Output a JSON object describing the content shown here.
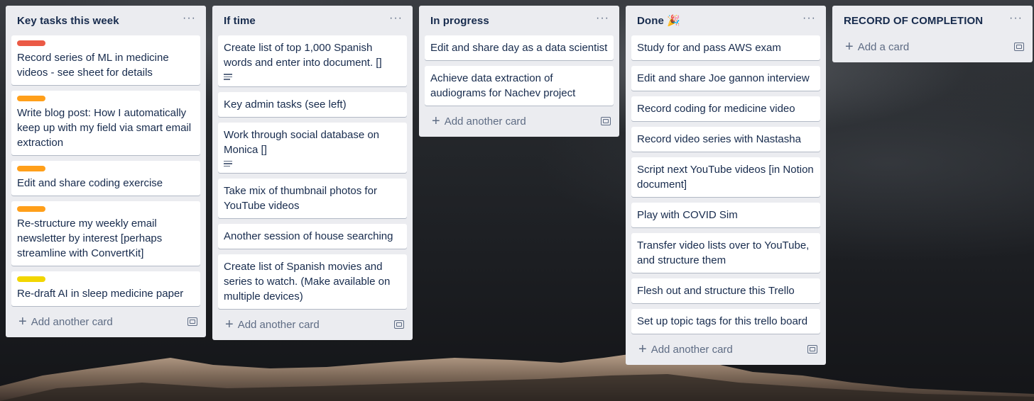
{
  "colors": {
    "red_label": "#eb5a46",
    "orange_label": "#ff9f1a",
    "yellow_label": "#f2d600"
  },
  "lists": [
    {
      "title": "Key tasks this week",
      "menu": "···",
      "add_label": "Add another card",
      "cards": [
        {
          "text": "Record series of ML in medicine videos - see sheet for details",
          "label_color": "red"
        },
        {
          "text": "Write blog post: How I automatically keep up with my field via smart email extraction",
          "label_color": "orange"
        },
        {
          "text": "Edit and share coding exercise",
          "label_color": "orange"
        },
        {
          "text": "Re-structure my weekly email newsletter by interest [perhaps streamline with ConvertKit]",
          "label_color": "orange"
        },
        {
          "text": "Re-draft AI in sleep medicine paper",
          "label_color": "yellow"
        }
      ]
    },
    {
      "title": "If time",
      "menu": "···",
      "add_label": "Add another card",
      "cards": [
        {
          "text": "Create list of top 1,000 Spanish words and enter into document. []",
          "has_description": true
        },
        {
          "text": "Key admin tasks (see left)"
        },
        {
          "text": "Work through social database on Monica []",
          "has_description": true
        },
        {
          "text": "Take mix of thumbnail photos for YouTube videos"
        },
        {
          "text": "Another session of house searching"
        },
        {
          "text": "Create list of Spanish movies and series to watch. (Make available on multiple devices)"
        }
      ]
    },
    {
      "title": "In progress",
      "menu": "···",
      "add_label": "Add another card",
      "cards": [
        {
          "text": "Edit and share day as a data scientist"
        },
        {
          "text": "Achieve data extraction of audiograms for Nachev project"
        }
      ]
    },
    {
      "title": "Done 🎉",
      "menu": "···",
      "add_label": "Add another card",
      "cards": [
        {
          "text": "Study for and pass AWS exam"
        },
        {
          "text": "Edit and share Joe gannon interview"
        },
        {
          "text": "Record coding for medicine video"
        },
        {
          "text": "Record video series with Nastasha"
        },
        {
          "text": "Script next YouTube videos [in Notion document]"
        },
        {
          "text": "Play with COVID Sim"
        },
        {
          "text": "Transfer video lists over to YouTube, and structure them"
        },
        {
          "text": "Flesh out and structure this Trello"
        },
        {
          "text": "Set up topic tags for this trello board"
        }
      ]
    },
    {
      "title": "RECORD OF COMPLETION",
      "menu": "···",
      "add_label": "Add a card",
      "cards": []
    }
  ]
}
